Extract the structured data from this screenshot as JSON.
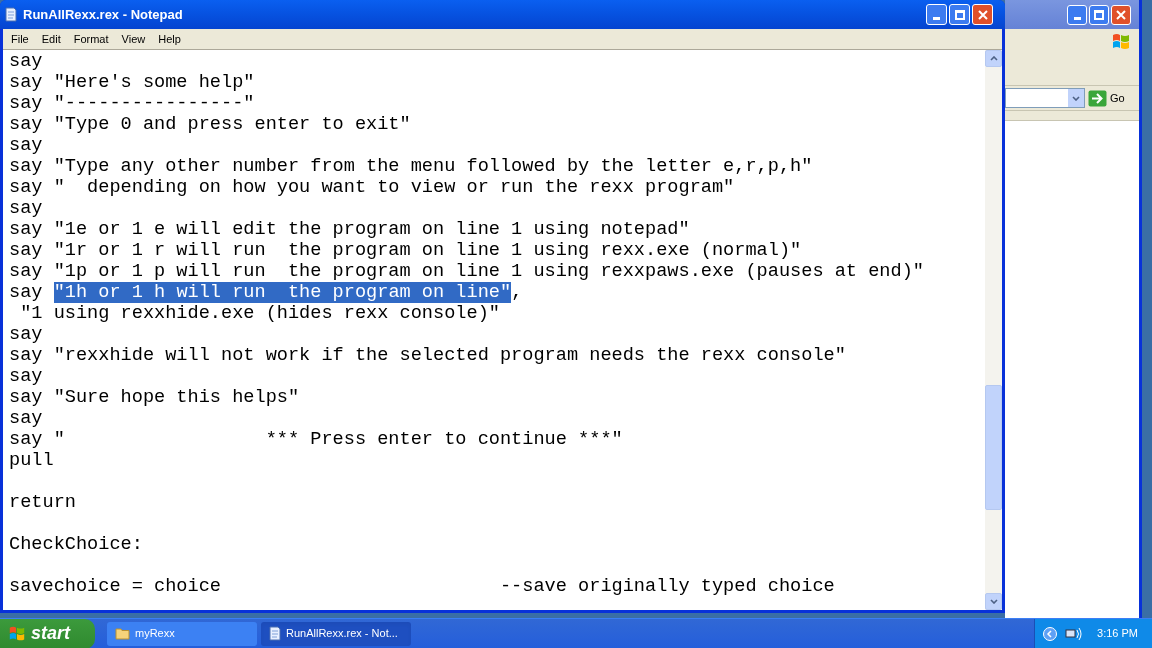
{
  "window": {
    "title": "RunAllRexx.rex - Notepad"
  },
  "menu": [
    "File",
    "Edit",
    "Format",
    "View",
    "Help"
  ],
  "editor": {
    "lines": [
      {
        "kind": "code",
        "segments": [
          {
            "text": "say",
            "selected": false
          }
        ]
      },
      {
        "kind": "code",
        "segments": [
          {
            "text": "say \"Here's some help\"",
            "selected": false
          }
        ]
      },
      {
        "kind": "code",
        "segments": [
          {
            "text": "say \"----------------\"",
            "selected": false
          }
        ]
      },
      {
        "kind": "code",
        "segments": [
          {
            "text": "say \"Type 0 and press enter to exit\"",
            "selected": false
          }
        ]
      },
      {
        "kind": "code",
        "segments": [
          {
            "text": "say",
            "selected": false
          }
        ]
      },
      {
        "kind": "code",
        "segments": [
          {
            "text": "say \"Type any other number from the menu followed by the letter e,r,p,h\"",
            "selected": false
          }
        ]
      },
      {
        "kind": "code",
        "segments": [
          {
            "text": "say \"  depending on how you want to view or run the rexx program\"",
            "selected": false
          }
        ]
      },
      {
        "kind": "code",
        "segments": [
          {
            "text": "say",
            "selected": false
          }
        ]
      },
      {
        "kind": "code",
        "segments": [
          {
            "text": "say \"1e or 1 e will edit the program on line 1 using notepad\"",
            "selected": false
          }
        ]
      },
      {
        "kind": "code",
        "segments": [
          {
            "text": "say \"1r or 1 r will run  the program on line 1 using rexx.exe (normal)\"",
            "selected": false
          }
        ]
      },
      {
        "kind": "code",
        "segments": [
          {
            "text": "say \"1p or 1 p will run  the program on line 1 using rexxpaws.exe (pauses at end)\"",
            "selected": false
          }
        ]
      },
      {
        "kind": "code",
        "segments": [
          {
            "text": "say ",
            "selected": false
          },
          {
            "text": "\"1h or 1 h will run  the program on line\"",
            "selected": true
          },
          {
            "text": ",",
            "selected": false
          }
        ]
      },
      {
        "kind": "code",
        "segments": [
          {
            "text": " \"1 using rexxhide.exe (hides rexx console)\"",
            "selected": false
          }
        ]
      },
      {
        "kind": "code",
        "segments": [
          {
            "text": "say",
            "selected": false
          }
        ]
      },
      {
        "kind": "code",
        "segments": [
          {
            "text": "say \"rexxhide will not work if the selected program needs the rexx console\"",
            "selected": false
          }
        ]
      },
      {
        "kind": "code",
        "segments": [
          {
            "text": "say",
            "selected": false
          }
        ]
      },
      {
        "kind": "code",
        "segments": [
          {
            "text": "say \"Sure hope this helps\"",
            "selected": false
          }
        ]
      },
      {
        "kind": "code",
        "segments": [
          {
            "text": "say",
            "selected": false
          }
        ]
      },
      {
        "kind": "code",
        "segments": [
          {
            "text": "say \"                  *** Press enter to continue ***\"",
            "selected": false
          }
        ]
      },
      {
        "kind": "code",
        "segments": [
          {
            "text": "pull",
            "selected": false
          }
        ]
      },
      {
        "kind": "blank"
      },
      {
        "kind": "code",
        "segments": [
          {
            "text": "return",
            "selected": false
          }
        ]
      },
      {
        "kind": "blank"
      },
      {
        "kind": "code",
        "segments": [
          {
            "text": "CheckChoice:",
            "selected": false
          }
        ]
      },
      {
        "kind": "blank"
      },
      {
        "kind": "code",
        "segments": [
          {
            "text": "savechoice = choice                         --save originally typed choice",
            "selected": false
          }
        ]
      }
    ]
  },
  "background_window": {
    "go_button": "Go"
  },
  "taskbar": {
    "start": "start",
    "tasks": [
      {
        "label": "myRexx",
        "selected": false,
        "kind": "folder"
      },
      {
        "label": "RunAllRexx.rex - Not...",
        "selected": true,
        "kind": "notepad"
      }
    ],
    "clock": "3:16 PM"
  }
}
